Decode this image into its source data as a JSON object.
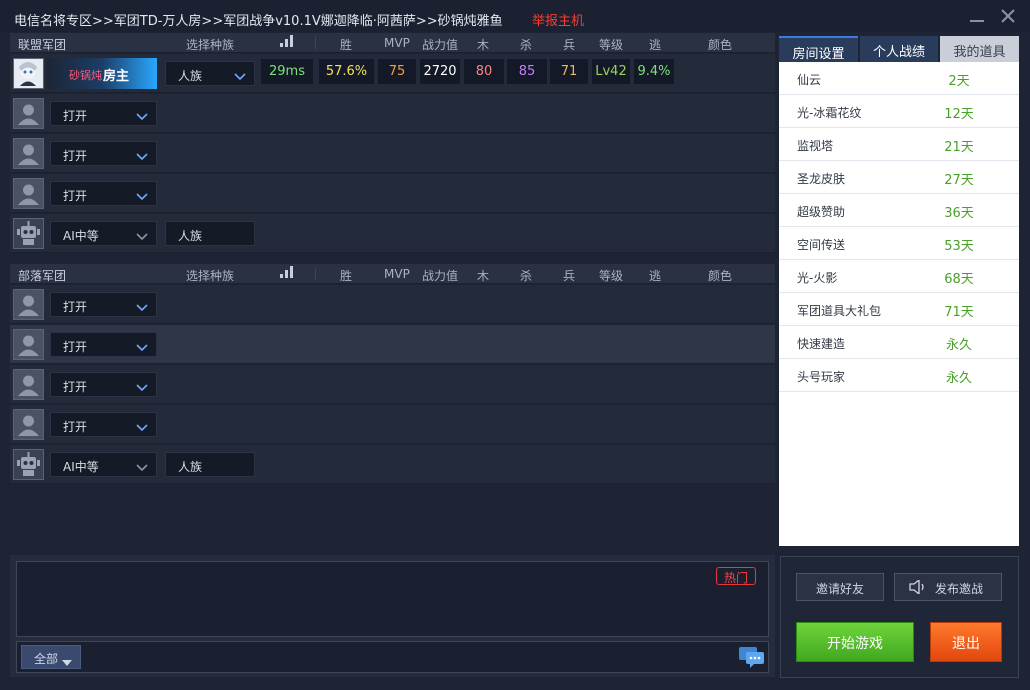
{
  "window": {
    "title": "电信名将专区>>军团TD-万人房>>军团战争v10.1V娜迦降临·阿茜萨>>砂锅炖雅鱼",
    "report_label": "举报主机"
  },
  "columns": {
    "race": "选择种族",
    "win": "胜",
    "mvp": "MVP",
    "power": "战力值",
    "wood": "木",
    "kill": "杀",
    "soldier": "兵",
    "level": "等级",
    "escape": "逃",
    "color": "颜色"
  },
  "alliance": {
    "name": "联盟军团",
    "host": {
      "nickname": "砂锅炖",
      "role": "房主",
      "race": "人族",
      "ping": "29ms",
      "win": "57.6%",
      "mvp": "75",
      "power": "2720",
      "wood": "80",
      "kill": "85",
      "soldier": "71",
      "level": "Lv42",
      "escape": "9.4%"
    },
    "slots": [
      {
        "state": "打开"
      },
      {
        "state": "打开"
      },
      {
        "state": "打开"
      }
    ],
    "ai": {
      "difficulty": "AI中等",
      "race": "人族"
    }
  },
  "horde": {
    "name": "部落军团",
    "slots": [
      {
        "state": "打开"
      },
      {
        "state": "打开"
      },
      {
        "state": "打开"
      },
      {
        "state": "打开"
      }
    ],
    "ai": {
      "difficulty": "AI中等",
      "race": "人族"
    }
  },
  "tabs": {
    "room_settings": "房间设置",
    "personal_record": "个人战绩",
    "my_items": "我的道具"
  },
  "items": [
    {
      "name": "仙云",
      "days": "2天"
    },
    {
      "name": "光-冰霜花纹",
      "days": "12天"
    },
    {
      "name": "监视塔",
      "days": "21天"
    },
    {
      "name": "圣龙皮肤",
      "days": "27天"
    },
    {
      "name": "超级赞助",
      "days": "36天"
    },
    {
      "name": "空间传送",
      "days": "53天"
    },
    {
      "name": "光-火影",
      "days": "68天"
    },
    {
      "name": "军团道具大礼包",
      "days": "71天"
    },
    {
      "name": "快速建造",
      "days": "永久"
    },
    {
      "name": "头号玩家",
      "days": "永久"
    }
  ],
  "chat": {
    "hot_label": "热门",
    "filter_label": "全部"
  },
  "actions": {
    "invite_friends": "邀请好友",
    "publish_challenge": "发布邀战",
    "start_game": "开始游戏",
    "exit": "退出"
  },
  "colors": {
    "ping": "#7fe07a",
    "win": "#f3e35a",
    "mvp": "#ff9a3c",
    "power": "#ffffff",
    "wood": "#ff8080",
    "kill": "#c77cff",
    "soldier": "#f0b860",
    "level": "#9ad35a",
    "escape": "#7fe07a"
  }
}
